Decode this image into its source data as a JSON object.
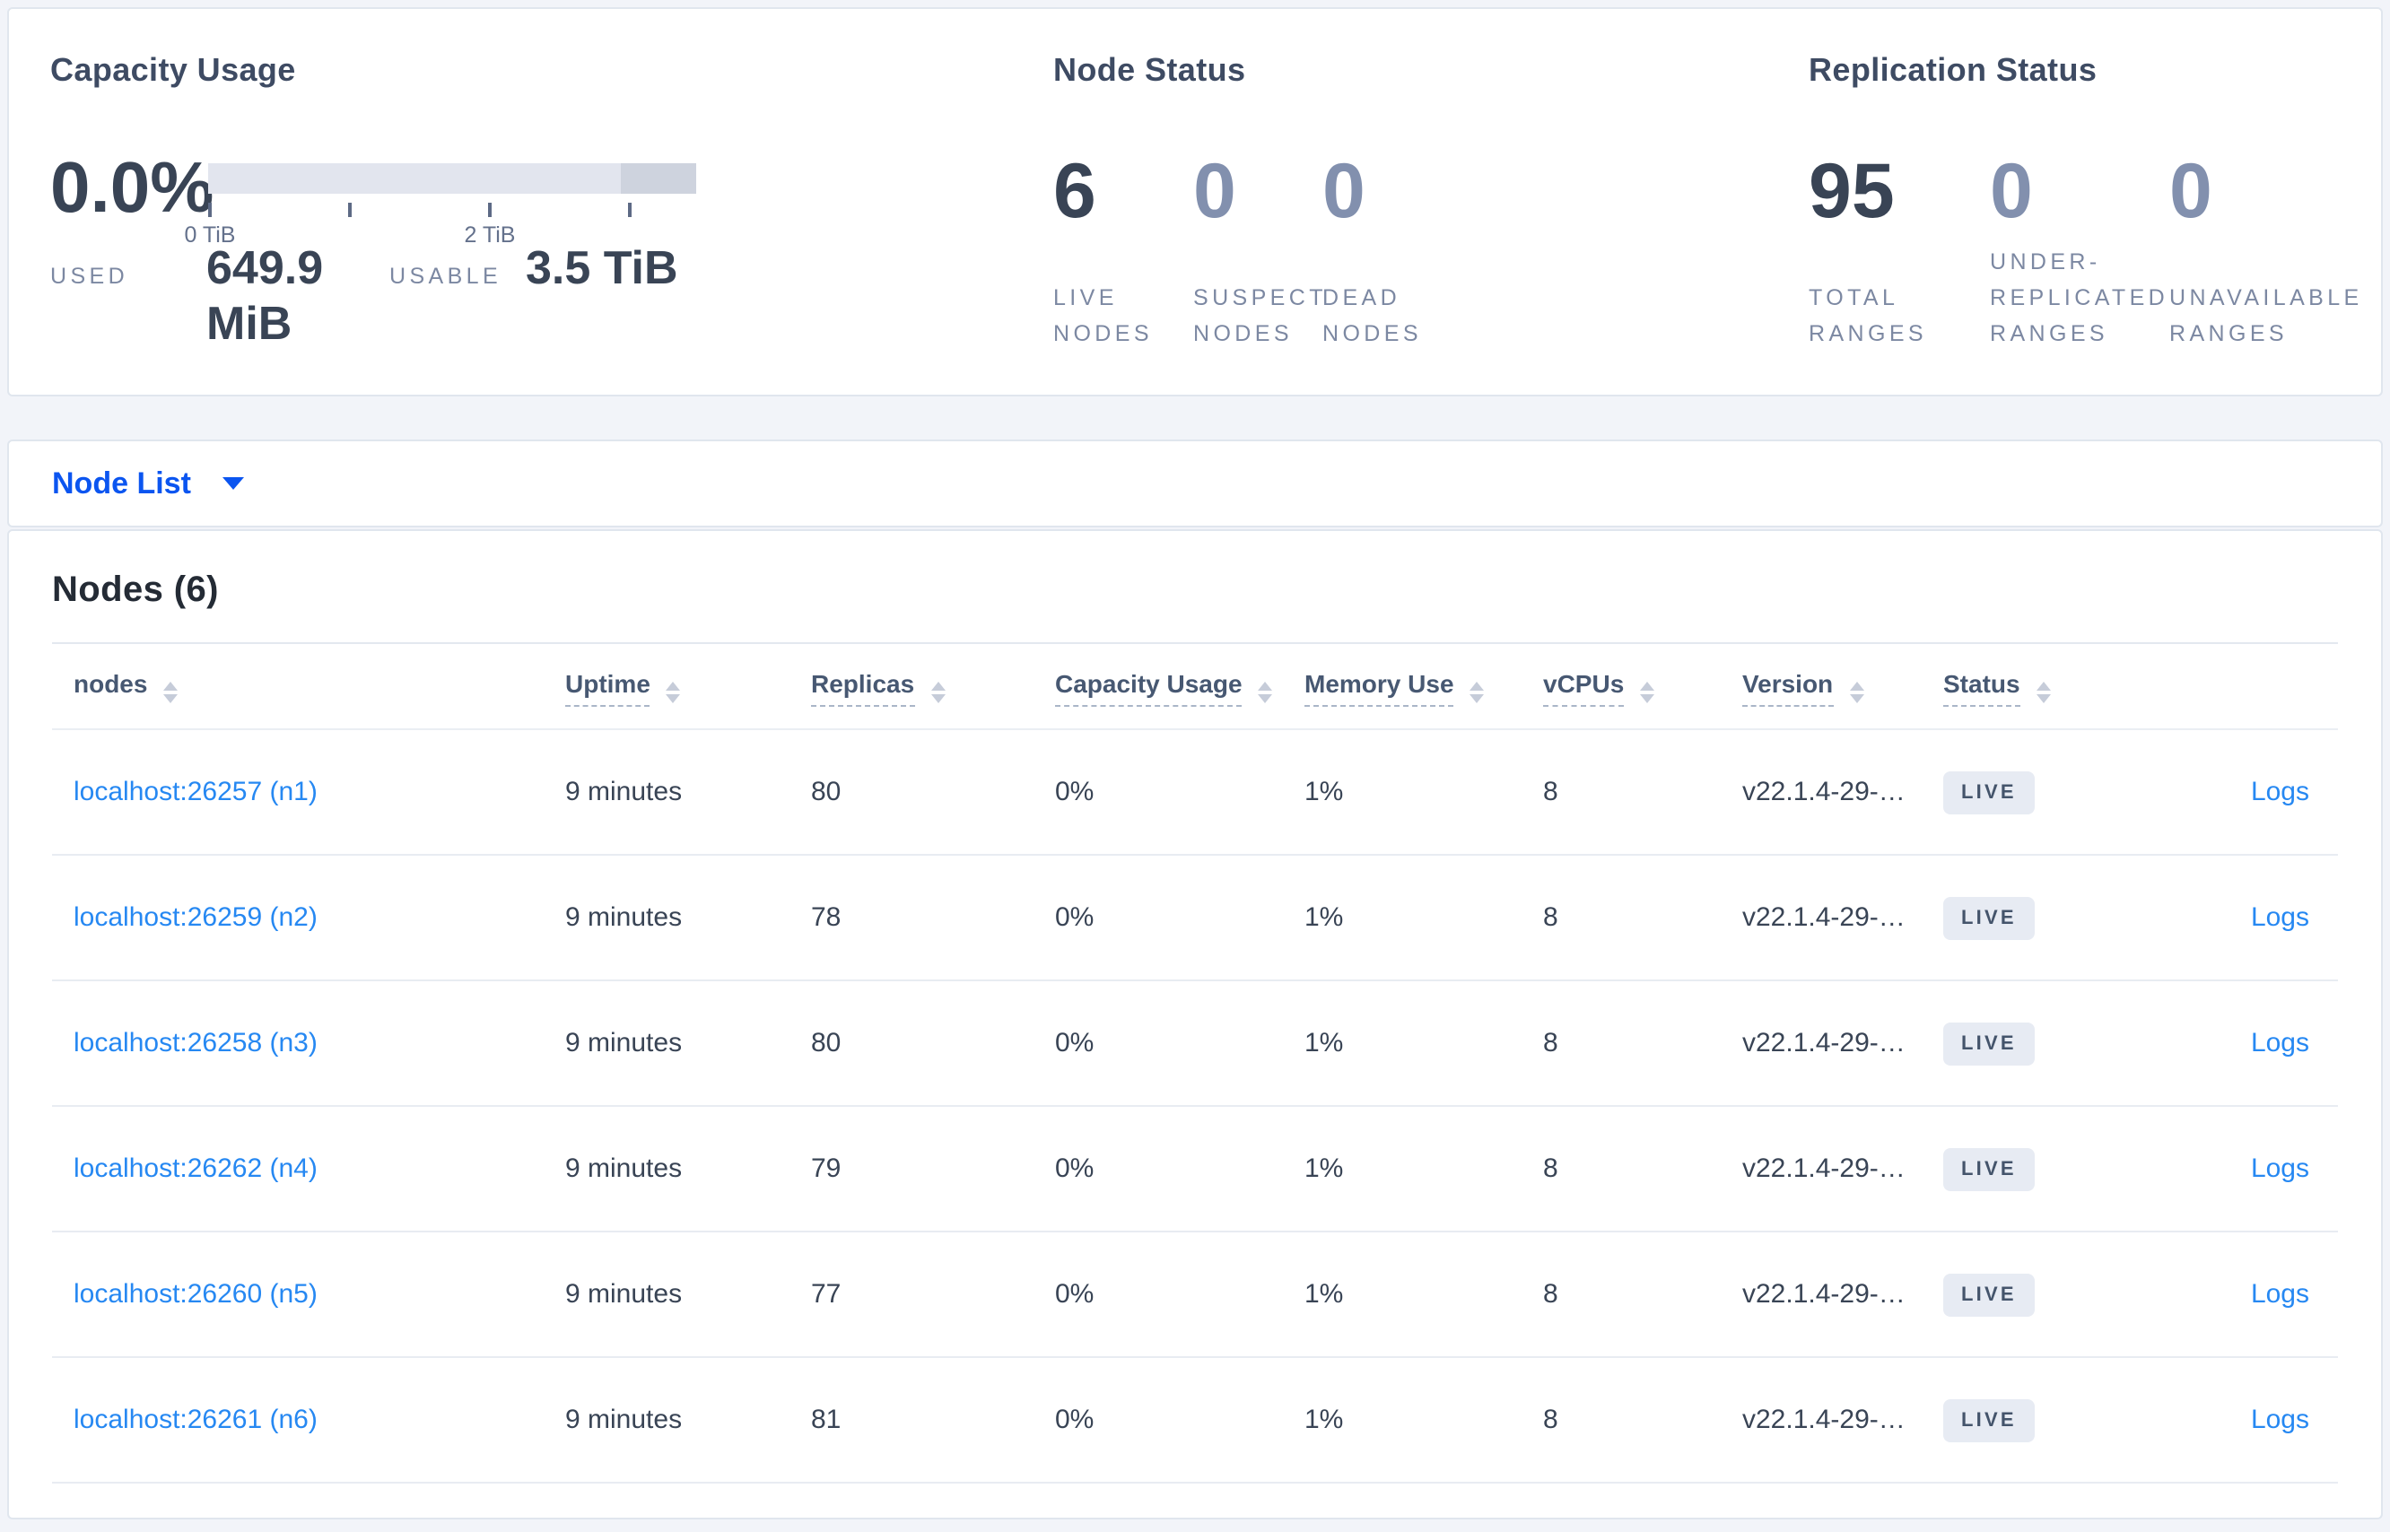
{
  "capacity": {
    "title": "Capacity Usage",
    "percent": "0.0%",
    "tick_labels": [
      "0 TiB",
      "2 TiB"
    ],
    "used_label": "USED",
    "used_value": "649.9 MiB",
    "usable_label": "USABLE",
    "usable_value": "3.5 TiB"
  },
  "node_status": {
    "title": "Node Status",
    "stats": [
      {
        "value": "6",
        "label": "LIVE NODES"
      },
      {
        "value": "0",
        "label": "SUSPECT NODES"
      },
      {
        "value": "0",
        "label": "DEAD NODES"
      }
    ]
  },
  "replication": {
    "title": "Replication Status",
    "stats": [
      {
        "value": "95",
        "label": "TOTAL RANGES"
      },
      {
        "value": "0",
        "label": "UNDER-REPLICATED RANGES"
      },
      {
        "value": "0",
        "label": "UNAVAILABLE RANGES"
      }
    ]
  },
  "node_list": {
    "label": "Node List"
  },
  "table": {
    "heading": "Nodes (6)",
    "columns": [
      "nodes",
      "Uptime",
      "Replicas",
      "Capacity Usage",
      "Memory Use",
      "vCPUs",
      "Version",
      "Status"
    ],
    "rows": [
      {
        "node": "localhost:26257 (n1)",
        "uptime": "9 minutes",
        "replicas": "80",
        "capacity": "0%",
        "memory": "1%",
        "vcpus": "8",
        "version": "v22.1.4-29-g…",
        "status": "LIVE",
        "logs": "Logs"
      },
      {
        "node": "localhost:26259 (n2)",
        "uptime": "9 minutes",
        "replicas": "78",
        "capacity": "0%",
        "memory": "1%",
        "vcpus": "8",
        "version": "v22.1.4-29-g…",
        "status": "LIVE",
        "logs": "Logs"
      },
      {
        "node": "localhost:26258 (n3)",
        "uptime": "9 minutes",
        "replicas": "80",
        "capacity": "0%",
        "memory": "1%",
        "vcpus": "8",
        "version": "v22.1.4-29-g…",
        "status": "LIVE",
        "logs": "Logs"
      },
      {
        "node": "localhost:26262 (n4)",
        "uptime": "9 minutes",
        "replicas": "79",
        "capacity": "0%",
        "memory": "1%",
        "vcpus": "8",
        "version": "v22.1.4-29-g…",
        "status": "LIVE",
        "logs": "Logs"
      },
      {
        "node": "localhost:26260 (n5)",
        "uptime": "9 minutes",
        "replicas": "77",
        "capacity": "0%",
        "memory": "1%",
        "vcpus": "8",
        "version": "v22.1.4-29-g…",
        "status": "LIVE",
        "logs": "Logs"
      },
      {
        "node": "localhost:26261 (n6)",
        "uptime": "9 minutes",
        "replicas": "81",
        "capacity": "0%",
        "memory": "1%",
        "vcpus": "8",
        "version": "v22.1.4-29-g…",
        "status": "LIVE",
        "logs": "Logs"
      }
    ]
  }
}
